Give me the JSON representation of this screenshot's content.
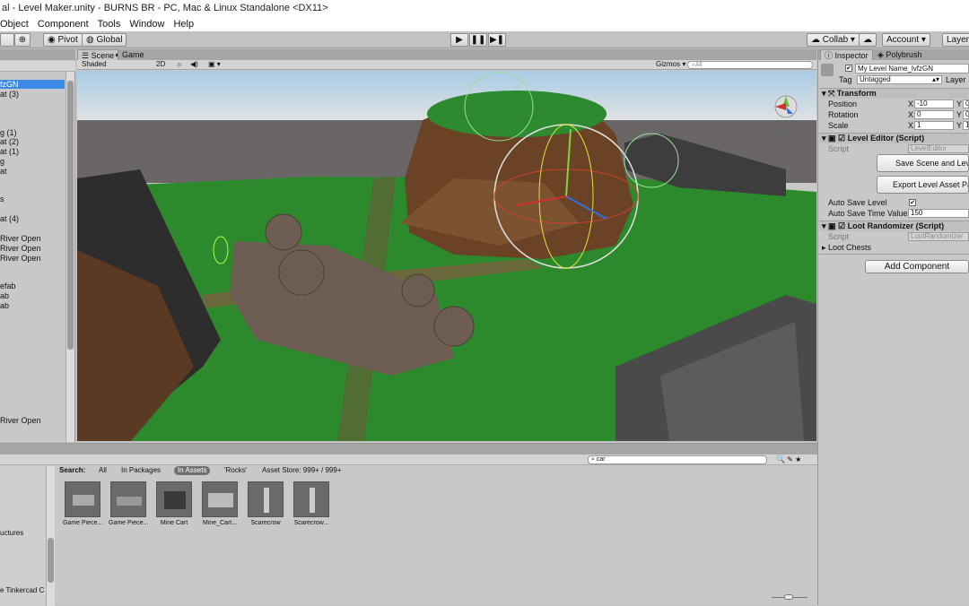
{
  "window": {
    "title": "al - Level Maker.unity - BURNS BR - PC, Mac & Linux Standalone <DX11>"
  },
  "menu": [
    "Object",
    "Component",
    "Tools",
    "Window",
    "Help"
  ],
  "toolbar": {
    "pivot": "Pivot",
    "global": "Global",
    "collab": "Collab",
    "account": "Account",
    "layers": "Layers",
    "play": "▶",
    "pause": "❚❚",
    "step": "▶❚"
  },
  "hierarchy": {
    "rows": [
      "fzGN",
      "at (3)",
      "g (1)",
      "at (2)",
      "at (1)",
      "g",
      "at",
      "s",
      "at (4)",
      "River Open",
      "River Open",
      "River Open",
      "efab",
      "ab",
      "ab",
      "River Open"
    ]
  },
  "scene": {
    "tabs": {
      "scene": "Scene",
      "game": "Game"
    },
    "shading": "Shaded",
    "mode_2d": "2D",
    "gizmos": "Gizmos",
    "search_placeholder": "All",
    "persp": "Persp"
  },
  "inspector": {
    "tabs": {
      "inspector": "Inspector",
      "polybrush": "Polybrush"
    },
    "object_name": "My Level Name_lvfzGN",
    "tag_label": "Tag",
    "tag_value": "Untagged",
    "layer_label": "Layer",
    "transform": {
      "title": "Transform",
      "position_label": "Position",
      "rotation_label": "Rotation",
      "scale_label": "Scale",
      "axis_x": "X",
      "axis_y": "Y",
      "position": {
        "x": "-10",
        "y": "0"
      },
      "rotation": {
        "x": "0",
        "y": "0"
      },
      "scale": {
        "x": "1",
        "y": "1"
      }
    },
    "level_editor": {
      "title": "Level Editor (Script)",
      "script_label": "Script",
      "script_value": "LevelEditor",
      "save_button": "Save Scene and Level",
      "export_button": "Export Level Asset Pack",
      "auto_save_label": "Auto Save Level",
      "auto_save_time_label": "Auto Save Time Value",
      "auto_save_time_value": "150"
    },
    "loot_randomizer": {
      "title": "Loot Randomizer (Script)",
      "script_label": "Script",
      "script_value": "LootRandomizer",
      "loot_chests": "Loot Chests"
    },
    "add_component": "Add Component"
  },
  "project": {
    "search_value": "car",
    "search_label": "Search:",
    "filters": [
      "All",
      "In Packages",
      "In Assets",
      "'Rocks'",
      "Asset Store: 999+ / 999+"
    ],
    "left_items": [
      "uctures",
      "e Tinkercad C"
    ],
    "assets": [
      "Game Piece...",
      "Game Piece...",
      "Mine Cart",
      "Mine_Cart...",
      "Scarecrow",
      "Scarecrow..."
    ]
  },
  "colors": {
    "selection": "#3d8ae6",
    "grass": "#2e8b2e",
    "sky_top": "#b8d6ea"
  }
}
